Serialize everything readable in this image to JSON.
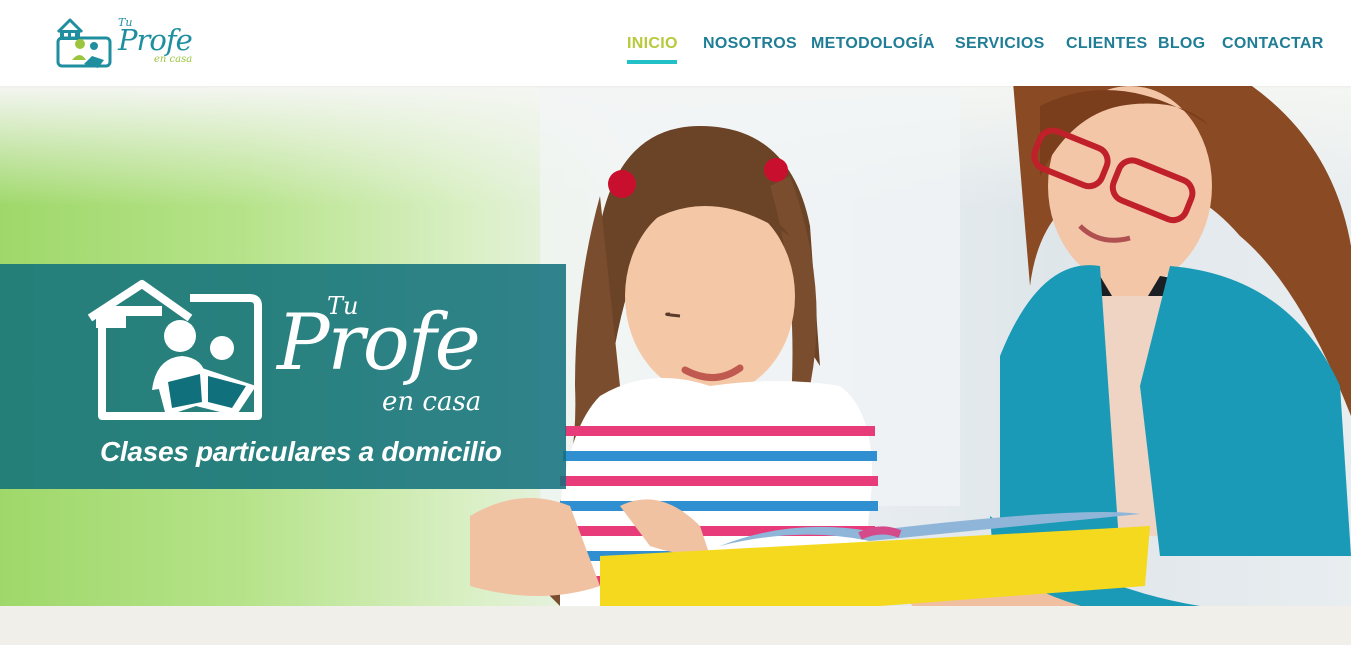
{
  "header": {
    "logo": {
      "tu": "Tu",
      "profe": "Profe",
      "encasa": "en casa"
    }
  },
  "nav": {
    "items": [
      {
        "label": "INICIO",
        "active": true
      },
      {
        "label": "NOSOTROS",
        "active": false
      },
      {
        "label": "METODOLOGÍA",
        "active": false
      },
      {
        "label": "SERVICIOS",
        "active": false
      },
      {
        "label": "CLIENTES",
        "active": false
      },
      {
        "label": "BLOG",
        "active": false
      },
      {
        "label": "CONTACTAR",
        "active": false
      }
    ]
  },
  "hero": {
    "brand": {
      "tu": "Tu",
      "profe": "Profe",
      "encasa": "en casa"
    },
    "tagline": "Clases particulares a domicilio",
    "image": "teacher-and-girl-reading-book-photo"
  },
  "colors": {
    "nav_text": "#1f7e96",
    "nav_active": "#b8c93a",
    "nav_underline": "#22c0c7",
    "brand_box": "#10707c",
    "logo_teal": "#1f8fa0",
    "logo_green": "#9bc53d"
  }
}
